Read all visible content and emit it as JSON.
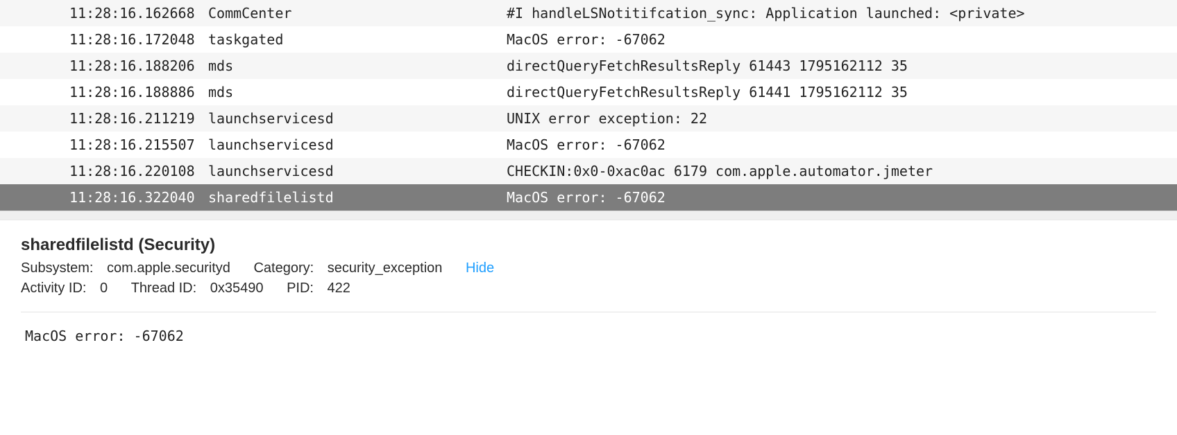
{
  "log": {
    "rows": [
      {
        "time": "11:28:16.162668",
        "process": "CommCenter",
        "message": "#I handleLSNotitifcation_sync: Application launched: <private>",
        "selected": false
      },
      {
        "time": "11:28:16.172048",
        "process": "taskgated",
        "message": "MacOS error: -67062",
        "selected": false
      },
      {
        "time": "11:28:16.188206",
        "process": "mds",
        "message": "directQueryFetchResultsReply 61443 1795162112 35",
        "selected": false
      },
      {
        "time": "11:28:16.188886",
        "process": "mds",
        "message": "directQueryFetchResultsReply 61441 1795162112 35",
        "selected": false
      },
      {
        "time": "11:28:16.211219",
        "process": "launchservicesd",
        "message": "UNIX error exception: 22",
        "selected": false
      },
      {
        "time": "11:28:16.215507",
        "process": "launchservicesd",
        "message": "MacOS error: -67062",
        "selected": false
      },
      {
        "time": "11:28:16.220108",
        "process": "launchservicesd",
        "message": "CHECKIN:0x0-0xac0ac 6179 com.apple.automator.jmeter",
        "selected": false
      },
      {
        "time": "11:28:16.322040",
        "process": "sharedfilelistd",
        "message": "MacOS error: -67062",
        "selected": true
      }
    ]
  },
  "details": {
    "title": "sharedfilelistd (Security)",
    "subsystem_label": "Subsystem:",
    "subsystem_value": "com.apple.securityd",
    "category_label": "Category:",
    "category_value": "security_exception",
    "hide_label": "Hide",
    "activity_label": "Activity ID:",
    "activity_value": "0",
    "thread_label": "Thread ID:",
    "thread_value": "0x35490",
    "pid_label": "PID:",
    "pid_value": "422",
    "body": "MacOS error: -67062"
  }
}
